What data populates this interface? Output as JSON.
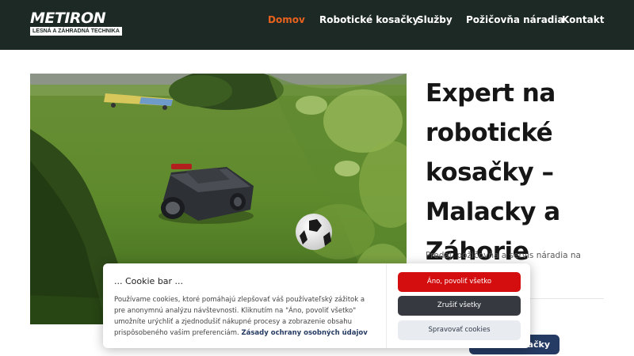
{
  "header": {
    "logo": {
      "name": "METIRON",
      "tagline": "LESNÁ A ZÁHRADNÁ TECHNIKA"
    },
    "nav": [
      {
        "label": "Domov",
        "active": true
      },
      {
        "label": "Robotické kosačky",
        "active": false
      },
      {
        "label": "Služby",
        "active": false
      },
      {
        "label": "Požičovňa náradia",
        "active": false
      },
      {
        "label": "Kontakt",
        "active": false
      }
    ]
  },
  "hero": {
    "title": "Expert na robotické kosačky – Malacky a Záhorie",
    "description": "Predaj, požičovňa a servis náradia na stavbu aj ... aj domácich",
    "cta_label": "kosačky"
  },
  "cookie_bar": {
    "title": "... Cookie bar ...",
    "text": "Používame cookies, ktoré pomáhajú zlepšovať váš používateľský zážitok a pre anonymnú analýzu návštevnosti. Kliknutím na \"Áno, povoliť všetko\" umožníte urýchliť a zjednodušiť nákupné procesy a zobrazenie obsahu prispôsobeného vašim preferenciám.",
    "privacy_link": "Zásady ochrany osobných údajov",
    "accept_label": "Áno, povoliť všetko",
    "reject_label": "Zrušiť všetky",
    "manage_label": "Spravovať cookies"
  },
  "colors": {
    "nav_background": "#1d2924",
    "nav_active": "#e8621e",
    "accept_button": "#d40e0e",
    "reject_button": "#363a40",
    "manage_button": "#e8ebef",
    "cta_button": "#253b63"
  }
}
